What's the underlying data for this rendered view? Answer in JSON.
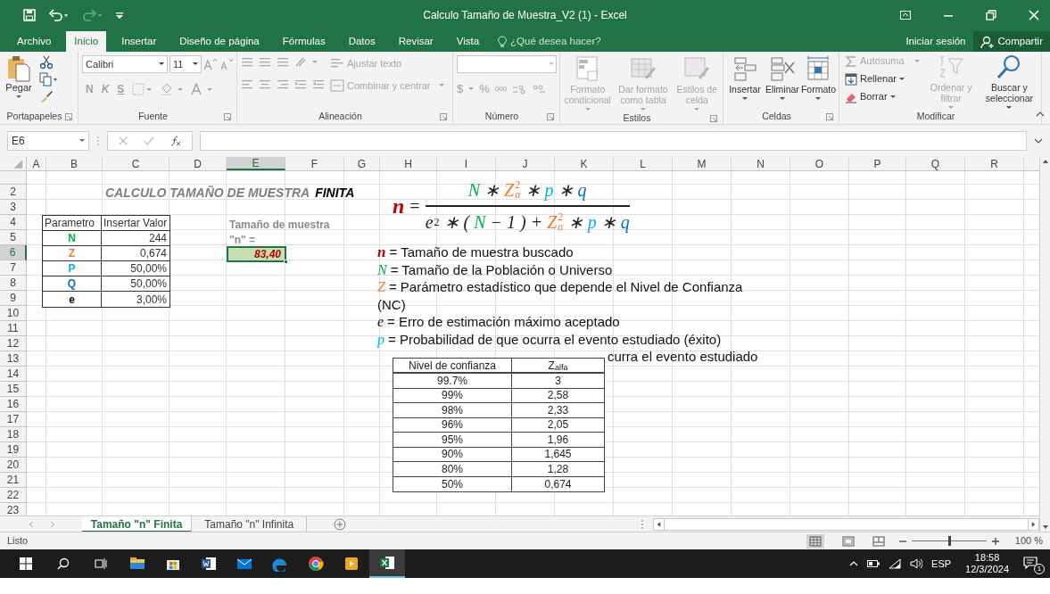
{
  "title_bar": {
    "title": "Calculo Tamaño de Muestra_V2 (1) - Excel"
  },
  "ribbon_tabs": [
    {
      "label": "Archivo",
      "selected": false
    },
    {
      "label": "Inicio",
      "selected": true
    },
    {
      "label": "Insertar",
      "selected": false
    },
    {
      "label": "Diseño de página",
      "selected": false
    },
    {
      "label": "Fórmulas",
      "selected": false
    },
    {
      "label": "Datos",
      "selected": false
    },
    {
      "label": "Revisar",
      "selected": false
    },
    {
      "label": "Vista",
      "selected": false
    }
  ],
  "tell_me": {
    "placeholder": "¿Qué desea hacer?"
  },
  "account": {
    "sign_in": "Iniciar sesión",
    "share": "Compartir"
  },
  "clipboard": {
    "label": "Portapapeles",
    "paste": "Pegar"
  },
  "font_group": {
    "label": "Fuente",
    "font": "Calibri",
    "size": "11",
    "bold": "N",
    "italic": "K",
    "underline": "S"
  },
  "alignment": {
    "label": "Alineación",
    "buttons": [
      {
        "label": "Ajustar texto",
        "disabled": true
      },
      {
        "label": "Combinar y centrar",
        "disabled": true
      }
    ]
  },
  "number": {
    "label": "Número",
    "currency": "$",
    "percent": "%",
    "thousands": "000"
  },
  "styles": {
    "label": "Estilos",
    "buttons": [
      {
        "label": "Formato condicional",
        "disabled": true
      },
      {
        "label": "Dar formato como tabla",
        "disabled": true
      },
      {
        "label": "Estilos de celda",
        "disabled": true
      }
    ]
  },
  "cells": {
    "label": "Celdas",
    "buttons": [
      {
        "label": "Insertar",
        "disabled": false
      },
      {
        "label": "Eliminar",
        "disabled": false
      },
      {
        "label": "Formato",
        "disabled": false
      }
    ]
  },
  "editing": {
    "label": "Modificar",
    "small": [
      {
        "label": "Autosuma",
        "disabled": true
      },
      {
        "label": "Rellenar",
        "disabled": false
      },
      {
        "label": "Borrar",
        "disabled": false
      }
    ],
    "large": [
      {
        "label": "Ordenar y filtrar",
        "disabled": true
      },
      {
        "label": "Buscar y seleccionar",
        "disabled": false
      }
    ]
  },
  "formula_bar": {
    "name_box": "E6"
  },
  "columns": [
    {
      "label": "A",
      "selected": false
    },
    {
      "label": "B",
      "selected": false
    },
    {
      "label": "C",
      "selected": false
    },
    {
      "label": "D",
      "selected": false
    },
    {
      "label": "E",
      "selected": true
    },
    {
      "label": "F",
      "selected": false
    },
    {
      "label": "G",
      "selected": false
    },
    {
      "label": "H",
      "selected": false
    },
    {
      "label": "I",
      "selected": false
    },
    {
      "label": "J",
      "selected": false
    },
    {
      "label": "K",
      "selected": false
    },
    {
      "label": "L",
      "selected": false
    },
    {
      "label": "M",
      "selected": false
    },
    {
      "label": "N",
      "selected": false
    },
    {
      "label": "O",
      "selected": false
    },
    {
      "label": "P",
      "selected": false
    },
    {
      "label": "Q",
      "selected": false
    },
    {
      "label": "R",
      "selected": false
    }
  ],
  "rows": [
    {
      "label": "2",
      "selected": false
    },
    {
      "label": "3",
      "selected": false
    },
    {
      "label": "4",
      "selected": false
    },
    {
      "label": "5",
      "selected": false
    },
    {
      "label": "6",
      "selected": true
    },
    {
      "label": "7",
      "selected": false
    },
    {
      "label": "8",
      "selected": false
    },
    {
      "label": "9",
      "selected": false
    },
    {
      "label": "10",
      "selected": false
    },
    {
      "label": "11",
      "selected": false
    },
    {
      "label": "12",
      "selected": false
    },
    {
      "label": "13",
      "selected": false
    },
    {
      "label": "14",
      "selected": false
    },
    {
      "label": "15",
      "selected": false
    },
    {
      "label": "16",
      "selected": false
    },
    {
      "label": "17",
      "selected": false
    },
    {
      "label": "18",
      "selected": false
    },
    {
      "label": "19",
      "selected": false
    },
    {
      "label": "20",
      "selected": false
    },
    {
      "label": "21",
      "selected": false
    },
    {
      "label": "22",
      "selected": false
    },
    {
      "label": "23",
      "selected": false
    }
  ],
  "sheet": {
    "title": "CALCULO TAMAÑO DE MUESTRA",
    "title_emphasis": "FINITA",
    "param_table": {
      "columns": [
        "Parametro",
        "Insertar Valor"
      ],
      "rows": [
        {
          "param": "N",
          "value": "244",
          "color": "#00b050"
        },
        {
          "param": "Z",
          "value": "0,674",
          "color": "#ed7d31"
        },
        {
          "param": "P",
          "value": "50,00%",
          "color": "#00b0f0"
        },
        {
          "param": "Q",
          "value": "50,00%",
          "color": "#0070c0"
        },
        {
          "param": "e",
          "value": "3,00%",
          "color": "#000000"
        }
      ]
    },
    "result": {
      "label": "Tamaño de muestra",
      "sublabel": "\"n\" =",
      "value": "83,40",
      "selected": true
    },
    "formula": {
      "lhs": "n",
      "equals": "=",
      "numerator": [
        {
          "text": "N",
          "color": "#00b050"
        },
        {
          "text": "∗"
        },
        {
          "text": "Z",
          "sup": "2",
          "sub": "α",
          "color": "#ed7d31"
        },
        {
          "text": "∗"
        },
        {
          "text": "p",
          "color": "#00b0f0"
        },
        {
          "text": "∗"
        },
        {
          "text": "q",
          "color": "#0070c0"
        }
      ],
      "denominator": [
        {
          "text": "e",
          "sup": "2"
        },
        {
          "text": "∗"
        },
        {
          "text": "("
        },
        {
          "text": "N",
          "color": "#00b050"
        },
        {
          "text": "−"
        },
        {
          "text": "1"
        },
        {
          "text": ")"
        },
        {
          "text": "+"
        },
        {
          "text": "Z",
          "sup": "2",
          "sub": "α",
          "color": "#ed7d31"
        },
        {
          "text": "∗"
        },
        {
          "text": "p",
          "color": "#00b0f0"
        },
        {
          "text": "∗"
        },
        {
          "text": "q",
          "color": "#0070c0"
        }
      ]
    },
    "legend": [
      {
        "symbol": "n",
        "color": "#c00000",
        "text": "= Tamaño de muestra buscado"
      },
      {
        "symbol": "N",
        "color": "#00b050",
        "text": "= Tamaño de la Población o Universo"
      },
      {
        "symbol": "Z",
        "color": "#ed7d31",
        "text": "= Parámetro estadístico que depende el Nivel de Confianza (NC)"
      },
      {
        "symbol": "e",
        "text": "= Erro de estimación máximo aceptado"
      },
      {
        "symbol": "p",
        "color": "#00b0f0",
        "text": "= Probabilidad de que ocurra el evento estudiado (éxito)"
      }
    ],
    "legend_cut": "curra el evento estudiado",
    "z_table": {
      "columns": [
        "Nivel de confianza",
        "Z$_{alfa}$"
      ],
      "rows": [
        [
          "99.7%",
          "3"
        ],
        [
          "99%",
          "2,58"
        ],
        [
          "98%",
          "2,33"
        ],
        [
          "96%",
          "2,05"
        ],
        [
          "95%",
          "1,96"
        ],
        [
          "90%",
          "1,645"
        ],
        [
          "80%",
          "1,28"
        ],
        [
          "50%",
          "0,674"
        ]
      ]
    }
  },
  "sheet_tabs": [
    {
      "label": "Tamaño \"n\" Finita",
      "selected": true
    },
    {
      "label": "Tamaño \"n\" Infinita",
      "selected": false
    }
  ],
  "status_bar": {
    "status": "Listo",
    "zoom": "100 %",
    "zoom_level": {
      "level": 0.5
    }
  },
  "taskbar": {
    "apps": [
      {
        "kind": "files",
        "selected": false
      },
      {
        "kind": "store",
        "selected": false
      },
      {
        "kind": "word",
        "selected": false
      },
      {
        "kind": "mail",
        "selected": false
      },
      {
        "kind": "edge",
        "selected": false
      },
      {
        "kind": "chrome",
        "selected": false
      },
      {
        "kind": "media",
        "selected": false
      },
      {
        "kind": "excel",
        "selected": true
      }
    ],
    "language": "ESP",
    "time": "18:58",
    "date": "12/3/2024",
    "notifications": "1"
  }
}
